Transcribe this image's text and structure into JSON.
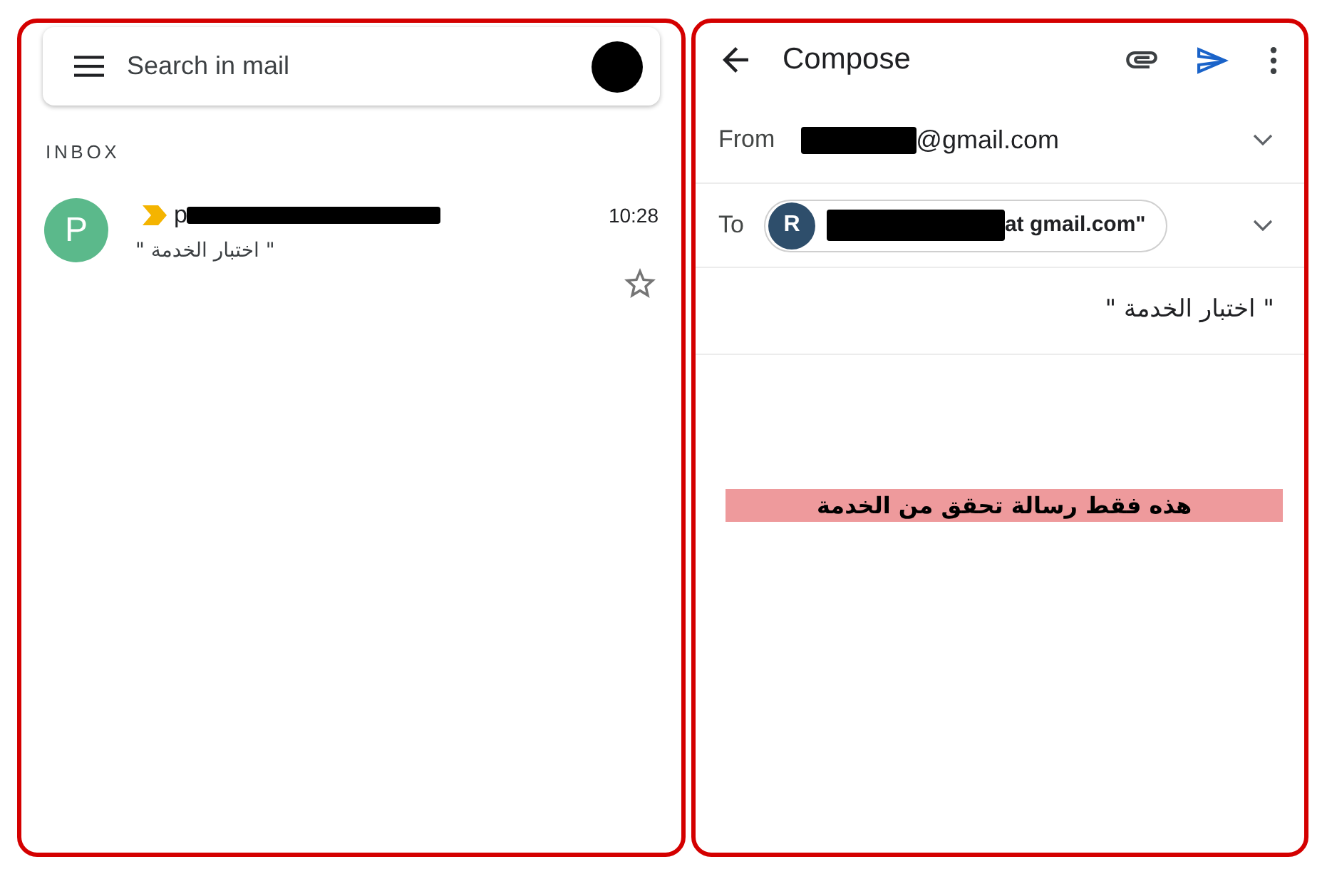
{
  "inbox": {
    "search": {
      "placeholder": "Search in mail"
    },
    "section_label": "INBOX",
    "emails": [
      {
        "initial": "P",
        "color": "#5bb98b",
        "important": true,
        "sender": "p",
        "sender_redacted": true,
        "time": "10:28",
        "snippet": "\" اختبار الخدمة \"",
        "starred": false
      }
    ]
  },
  "compose": {
    "title": "Compose",
    "from": {
      "label": "From",
      "redacted": true,
      "address": "@gmail.com"
    },
    "to": {
      "label": "To",
      "recipients": [
        {
          "initial": "R",
          "color": "#2e4e6b",
          "redacted": true,
          "address": "at gmail.com\""
        }
      ]
    },
    "subject": "\" اختبار الخدمة \"",
    "body": "هذه فقط رسالة تحقق من الخدمة"
  }
}
